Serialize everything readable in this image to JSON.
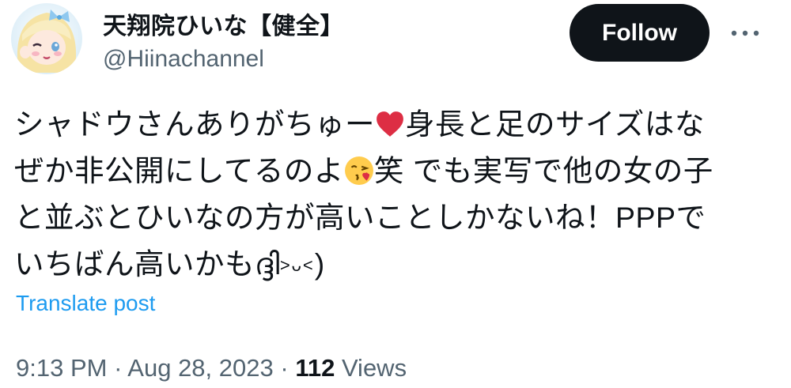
{
  "author": {
    "display_name": "天翔院ひいな【健全】",
    "handle": "@Hiinachannel"
  },
  "header": {
    "follow_label": "Follow",
    "more_label": "···"
  },
  "tweet": {
    "lines": {
      "l1_a": "シャドウさんありがちゅー",
      "l1_b": "身長と足のサイズはな",
      "l2_a": "ぜか非公開にしてるのよ",
      "l2_b": "笑 でも実写で他の女の子",
      "l3": "と並ぶとひいなの方が高いことしかないね！PPPで",
      "l4_a": "いちばん高いかも",
      "l4_b": "ദ്ദി",
      "l4_c": "˃ᴗ˂",
      "l4_d": ")"
    },
    "emojis": [
      "red-heart",
      "face-blowing-kiss"
    ]
  },
  "translate_label": "Translate post",
  "meta": {
    "time": "9:13 PM",
    "separator": " · ",
    "date": "Aug 28, 2023",
    "views_count": "112",
    "views_label": " Views"
  },
  "colors": {
    "text": "#0f1419",
    "secondary": "#536471",
    "link": "#1d9bf0",
    "button_bg": "#0f1419"
  }
}
